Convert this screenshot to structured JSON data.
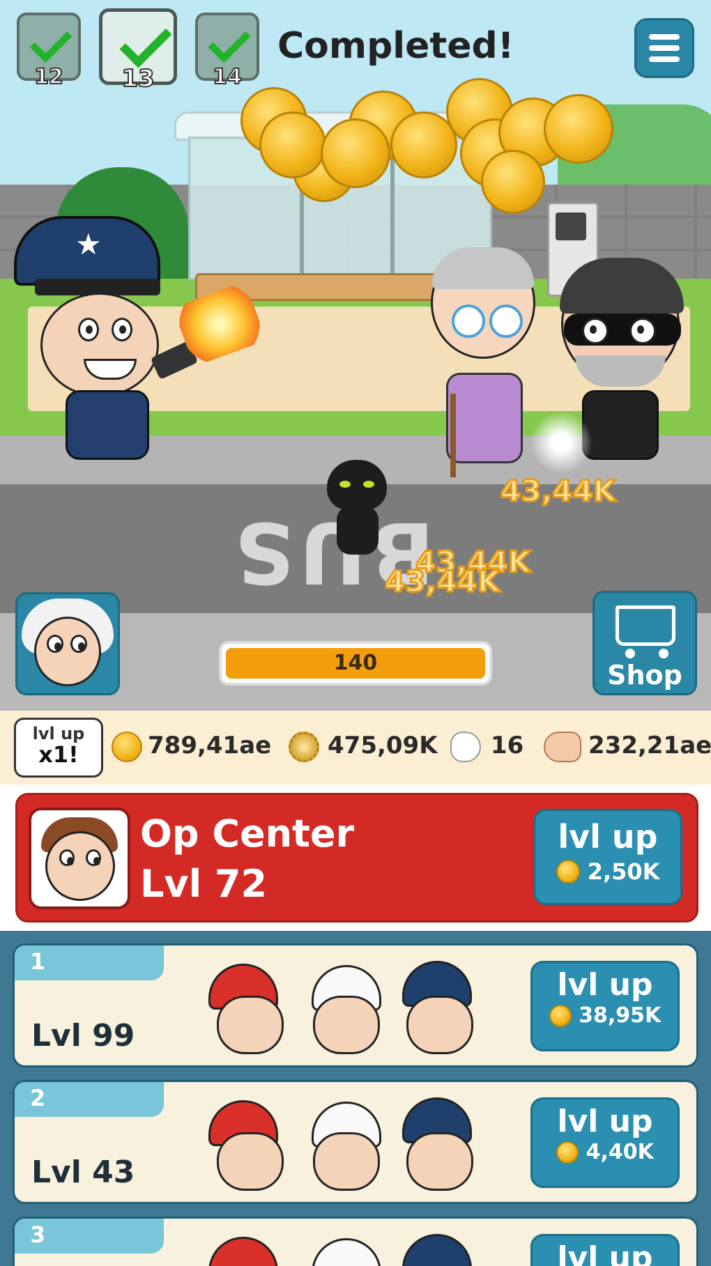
{
  "header": {
    "levels": [
      {
        "num": "12",
        "completed": true
      },
      {
        "num": "13",
        "completed": true,
        "current": true
      },
      {
        "num": "14",
        "completed": true
      }
    ],
    "status_text": "Completed!"
  },
  "scene": {
    "damage_popups": [
      "43,44K",
      "43,44K",
      "43,44K"
    ],
    "road_text": "BUS",
    "progress": {
      "value_text": "140",
      "fill_fraction": 1.0
    }
  },
  "shop_button": {
    "label": "Shop"
  },
  "resources": {
    "lvl_up_bubble": {
      "line1": "lvl up",
      "line2": "x1!"
    },
    "coins": "789,41ae",
    "gems": "475,09K",
    "taps": "16",
    "strength": "232,21ae"
  },
  "op_center": {
    "name": "Op Center",
    "level": "Lvl 72",
    "button_label": "lvl up",
    "button_cost": "2,50K"
  },
  "rows": [
    {
      "index": "1",
      "level": "Lvl 99",
      "button_label": "lvl up",
      "button_cost": "38,95K"
    },
    {
      "index": "2",
      "level": "Lvl 43",
      "button_label": "lvl up",
      "button_cost": "4,40K"
    },
    {
      "index": "3",
      "level": "",
      "button_label": "lvl up",
      "button_cost": ""
    }
  ],
  "colors": {
    "sky": "#bfe8f5",
    "accent_blue": "#2a8fb0",
    "op_center_red": "#d42a25",
    "progress_orange": "#f59e0b",
    "resource_bar_bg": "#fbeed2"
  }
}
